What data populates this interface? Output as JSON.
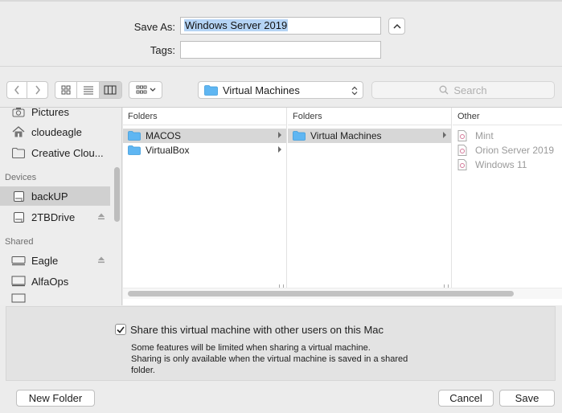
{
  "save_as": {
    "label": "Save As:",
    "value": "Windows Server 2019"
  },
  "tags": {
    "label": "Tags:",
    "value": ""
  },
  "toolbar": {
    "location": "Virtual Machines",
    "search_placeholder": "Search"
  },
  "sidebar": {
    "favorites": [
      {
        "label": "Pictures",
        "icon": "camera-icon"
      },
      {
        "label": "cloudeagle",
        "icon": "home-icon"
      },
      {
        "label": "Creative Clou...",
        "icon": "folder-icon"
      }
    ],
    "devices_header": "Devices",
    "devices": [
      {
        "label": "backUP",
        "icon": "drive-icon",
        "selected": true
      },
      {
        "label": "2TBDrive",
        "icon": "drive-icon",
        "eject": true
      }
    ],
    "shared_header": "Shared",
    "shared": [
      {
        "label": "Eagle",
        "icon": "server-icon",
        "eject": true
      },
      {
        "label": "AlfaOps",
        "icon": "monitor-icon"
      }
    ]
  },
  "columns": [
    {
      "header": "Folders",
      "items": [
        {
          "label": "MACOS",
          "selected": true
        },
        {
          "label": "VirtualBox"
        }
      ]
    },
    {
      "header": "Folders",
      "items": [
        {
          "label": "Virtual Machines",
          "selected": true
        }
      ]
    },
    {
      "header": "Other",
      "items": [
        {
          "label": "Mint"
        },
        {
          "label": "Orion Server 2019"
        },
        {
          "label": "Windows 11"
        }
      ]
    }
  ],
  "share": {
    "checked": true,
    "label": "Share this virtual machine with other users on this Mac",
    "note_line1": "Some features will be limited when sharing a virtual machine.",
    "note_line2": "Sharing is only available when the virtual machine is saved in a shared",
    "note_line3": "folder."
  },
  "buttons": {
    "new_folder": "New Folder",
    "cancel": "Cancel",
    "save": "Save"
  },
  "colors": {
    "folder_blue": "#5fb6f2",
    "selection_gray": "#d0d0d0",
    "text_selection": "#b5d4f5"
  }
}
